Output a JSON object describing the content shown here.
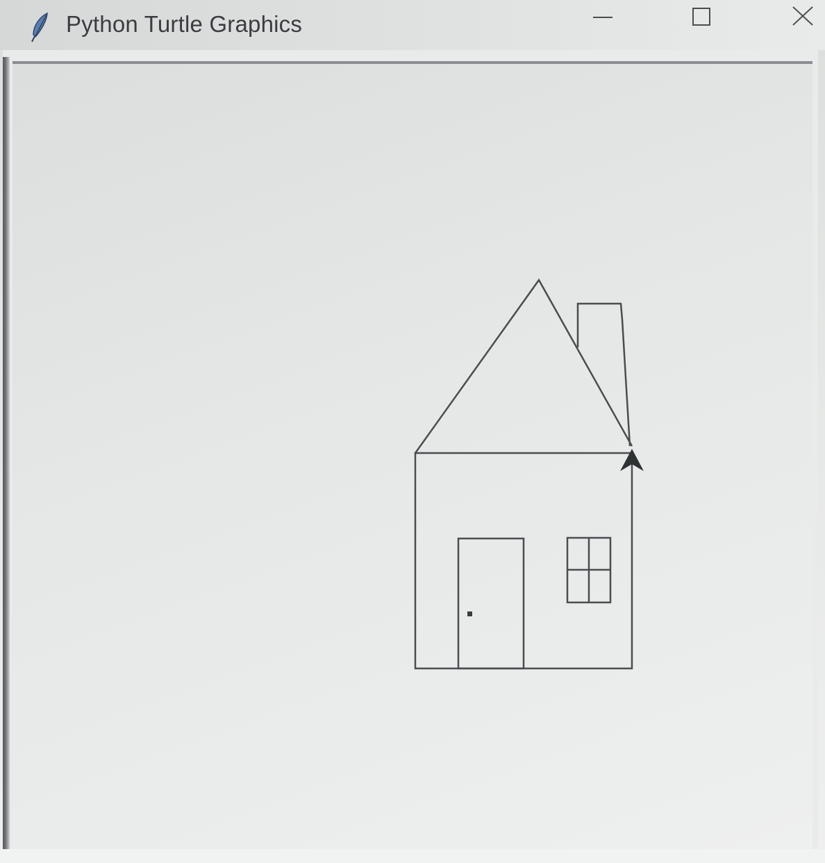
{
  "window": {
    "title": "Python Turtle Graphics",
    "app_icon": "feather-icon",
    "controls": {
      "minimize": "minimize-icon",
      "maximize": "maximize-icon",
      "close": "close-icon"
    }
  },
  "canvas": {
    "background": "#ececec",
    "pen_color": "#4a4d50",
    "turtle_color": "#2f3234",
    "turtle_shape": "arrow-cursor-icon",
    "drawing": "house with roof, chimney, door with knob, and four-pane window"
  },
  "colors": {
    "titlebar": "#e0e2e2",
    "title_text": "#3a3d40",
    "icon_blue": "#5b7fb0"
  }
}
